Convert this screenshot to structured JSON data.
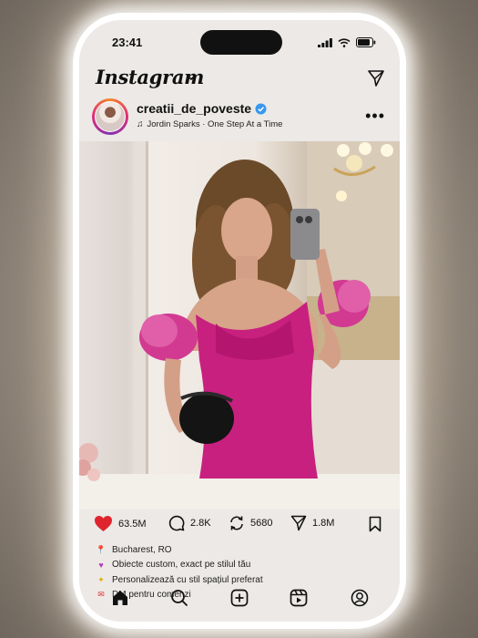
{
  "status_bar": {
    "time": "23:41"
  },
  "app": {
    "logo_text": "Instagram"
  },
  "post": {
    "username": "creatii_de_poveste",
    "verified": true,
    "music": "Jordin Sparks · One Step At a Time",
    "photo_description_icon": "mirror-selfie-photo",
    "stats": {
      "likes": "63.5M",
      "comments": "2.8K",
      "reposts": "5680",
      "shares": "1.8M"
    },
    "caption": [
      {
        "icon": "pin-icon",
        "text": "Bucharest, RO"
      },
      {
        "icon": "heart-emoji-icon",
        "text": "Obiecte custom, exact pe stilul tău"
      },
      {
        "icon": "sparkle-icon",
        "text": "Personalizează cu stil spațiul preferat"
      },
      {
        "icon": "envelope-icon",
        "text": "DM pentru comenzi"
      }
    ]
  },
  "colors": {
    "like_red": "#e0242e",
    "verified_blue": "#3897f0",
    "dress_magenta": "#c8207f",
    "screen_bg": "#ece9e6"
  },
  "tab_bar": [
    "home-icon",
    "search-icon",
    "create-icon",
    "reels-icon",
    "profile-icon"
  ]
}
